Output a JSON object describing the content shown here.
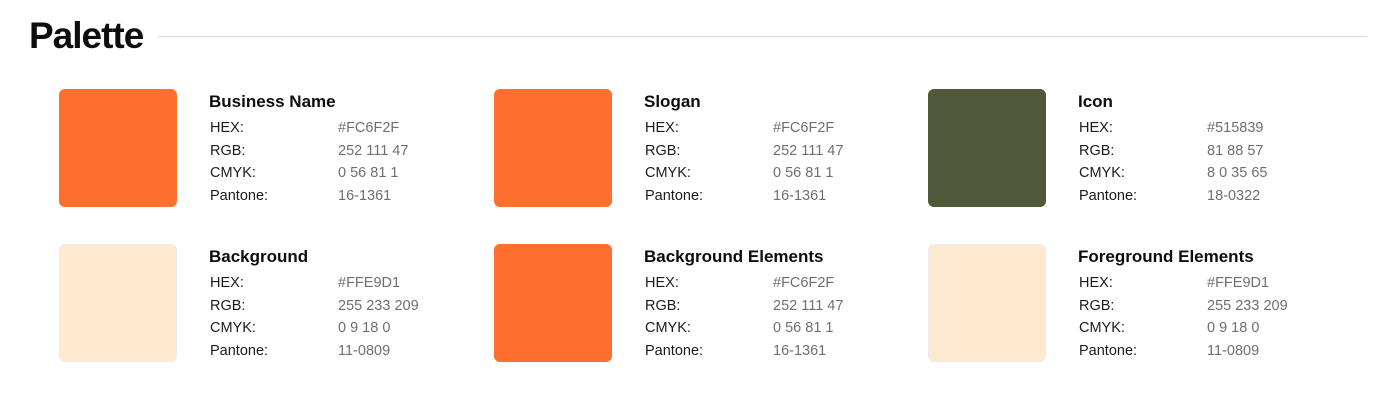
{
  "section": {
    "title": "Palette"
  },
  "labels": {
    "hex": "HEX:",
    "rgb": "RGB:",
    "cmyk": "CMYK:",
    "pantone": "Pantone:"
  },
  "colors": [
    {
      "name": "Business Name",
      "hex": "#FC6F2F",
      "rgb": "252 111 47",
      "cmyk": "0 56 81 1",
      "pantone": "16-1361",
      "swatch": "#FC6F2F"
    },
    {
      "name": "Slogan",
      "hex": "#FC6F2F",
      "rgb": "252 111 47",
      "cmyk": "0 56 81 1",
      "pantone": "16-1361",
      "swatch": "#FC6F2F"
    },
    {
      "name": "Icon",
      "hex": "#515839",
      "rgb": "81 88 57",
      "cmyk": "8 0 35 65",
      "pantone": "18-0322",
      "swatch": "#515839"
    },
    {
      "name": "Background",
      "hex": "#FFE9D1",
      "rgb": "255 233 209",
      "cmyk": "0 9 18 0",
      "pantone": "11-0809",
      "swatch": "#FFE9D1"
    },
    {
      "name": "Background Elements",
      "hex": "#FC6F2F",
      "rgb": "252 111 47",
      "cmyk": "0 56 81 1",
      "pantone": "16-1361",
      "swatch": "#FC6F2F"
    },
    {
      "name": "Foreground Elements",
      "hex": "#FFE9D1",
      "rgb": "255 233 209",
      "cmyk": "0 9 18 0",
      "pantone": "11-0809",
      "swatch": "#FFE9D1"
    }
  ]
}
